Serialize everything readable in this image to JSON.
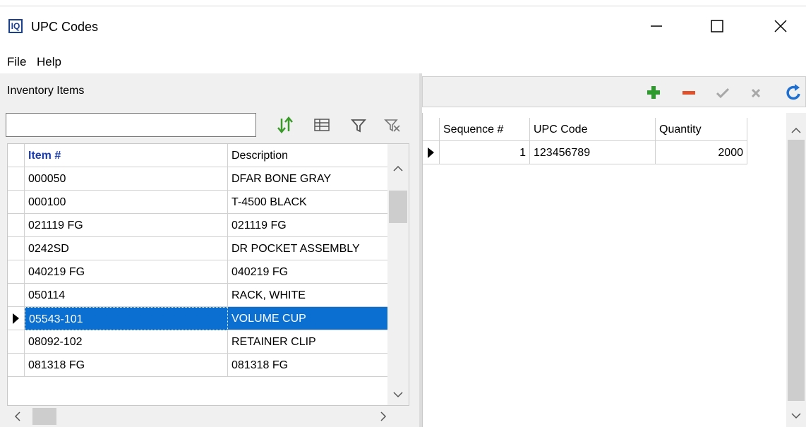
{
  "window": {
    "title": "UPC Codes",
    "app_icon_text": "IQ",
    "minimize": "—",
    "maximize": "☐",
    "close": "✕"
  },
  "menu": [
    "File",
    "Help"
  ],
  "left_panel": {
    "title": "Inventory Items",
    "search": {
      "value": "",
      "placeholder": ""
    },
    "columns": [
      "Item #",
      "Description"
    ],
    "rows": [
      {
        "item": "000050",
        "description": "DFAR BONE GRAY"
      },
      {
        "item": "000100",
        "description": "T-4500 BLACK"
      },
      {
        "item": "021119 FG",
        "description": "021119 FG"
      },
      {
        "item": "0242SD",
        "description": "DR POCKET ASSEMBLY"
      },
      {
        "item": "040219 FG",
        "description": "040219 FG"
      },
      {
        "item": "050114",
        "description": "RACK, WHITE"
      },
      {
        "item": "05543-101",
        "description": "VOLUME CUP"
      },
      {
        "item": "08092-102",
        "description": "RETAINER CLIP"
      },
      {
        "item": "081318 FG",
        "description": "081318 FG"
      }
    ],
    "selected_index": 6
  },
  "right_panel": {
    "columns": [
      "Sequence #",
      "UPC Code",
      "Quantity"
    ],
    "rows": [
      {
        "sequence": "1",
        "upc": "123456789",
        "quantity": "2000"
      }
    ]
  },
  "colors": {
    "selection": "#0a6fd1",
    "add": "#2e9a2e",
    "remove": "#e0502a",
    "refresh": "#1e6fd0"
  }
}
